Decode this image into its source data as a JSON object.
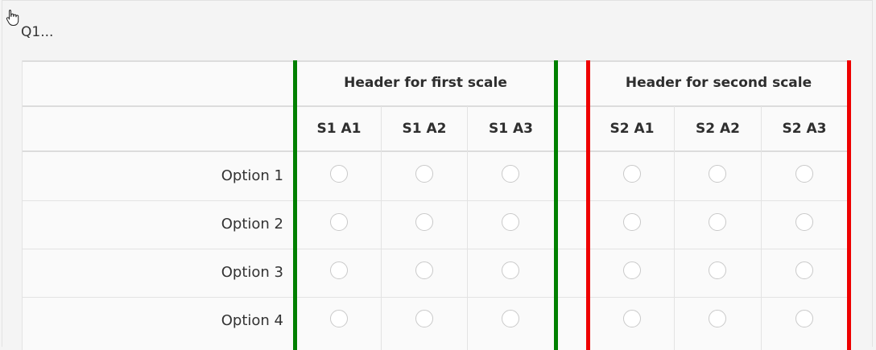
{
  "question": {
    "title": "Q1..."
  },
  "scales": [
    {
      "header": "Header for first scale",
      "answers": [
        "S1 A1",
        "S1 A2",
        "S1 A3"
      ],
      "accent_color": "#008000"
    },
    {
      "header": "Header for second scale",
      "answers": [
        "S2 A1",
        "S2 A2",
        "S2 A3"
      ],
      "accent_color": "#ee0000"
    }
  ],
  "rows": [
    {
      "label": "Option 1"
    },
    {
      "label": "Option 2"
    },
    {
      "label": "Option 3"
    },
    {
      "label": "Option 4"
    }
  ],
  "icons": {
    "cursor": "hand-pointer-icon",
    "answer": "radio-button-icon"
  }
}
